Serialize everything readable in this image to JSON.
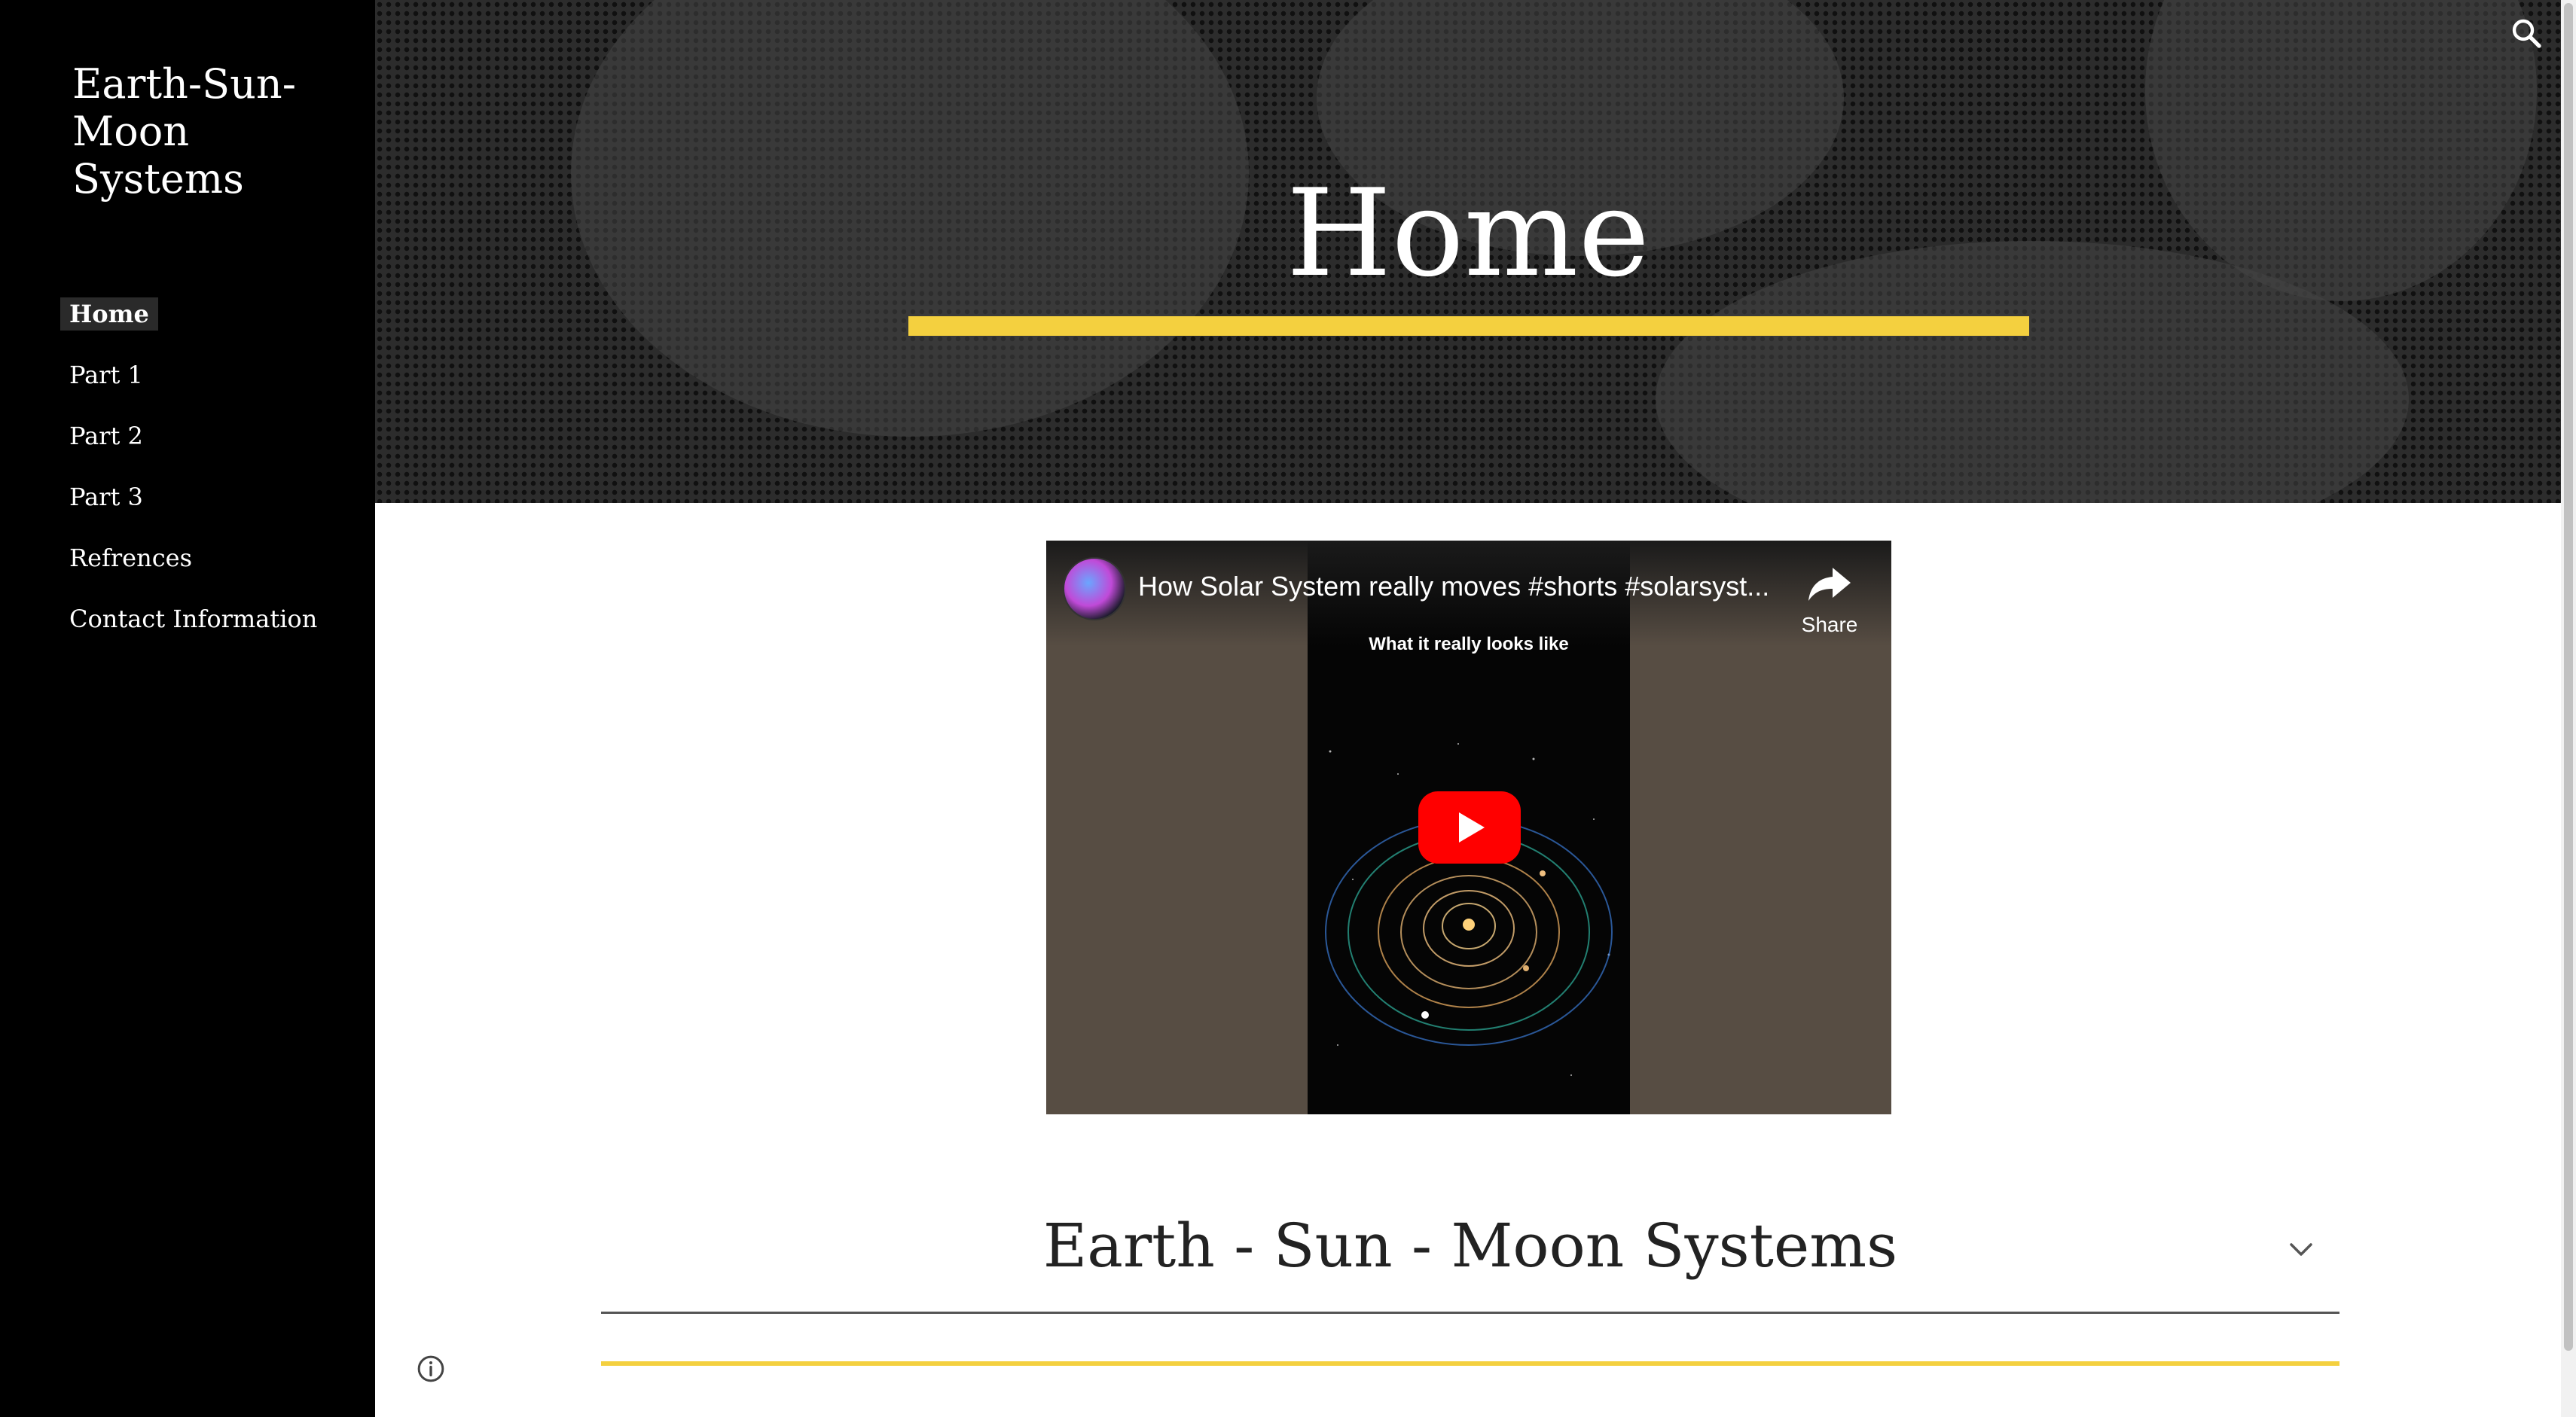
{
  "site": {
    "title": "Earth-Sun-Moon Systems"
  },
  "nav": {
    "items": [
      {
        "label": "Home",
        "active": true
      },
      {
        "label": "Part 1",
        "active": false
      },
      {
        "label": "Part 2",
        "active": false
      },
      {
        "label": "Part 3",
        "active": false
      },
      {
        "label": "Refrences",
        "active": false
      },
      {
        "label": "Contact Information",
        "active": false
      }
    ]
  },
  "header": {
    "title": "Home",
    "accent_color": "#f4d03f"
  },
  "video": {
    "title": "How Solar System really moves #shorts #solarsyst...",
    "share_label": "Share",
    "overlay_text": "What it really looks like",
    "play_color": "#ff0000"
  },
  "section": {
    "title": "Earth - Sun - Moon Systems"
  },
  "icons": [
    "search-icon",
    "share-icon",
    "play-icon",
    "chevron-down-icon",
    "info-icon"
  ]
}
